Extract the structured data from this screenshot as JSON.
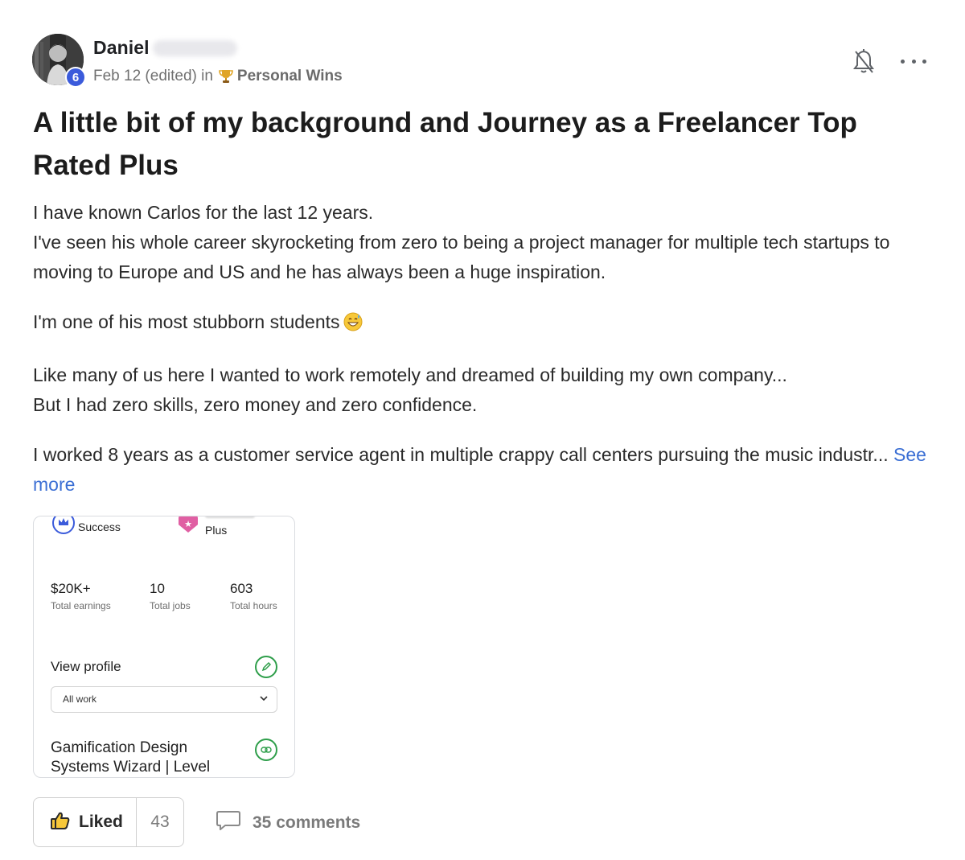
{
  "author": {
    "first_name": "Daniel",
    "level": "6"
  },
  "meta": {
    "date": "Feb 12 (edited) in",
    "category": "Personal Wins"
  },
  "post": {
    "title": "A little bit of my background and Journey as a Freelancer Top Rated Plus",
    "paragraphs": [
      [
        "I have known Carlos for the last 12 years.",
        "I've seen his whole career skyrocketing from zero to being a project manager for multiple tech startups to moving to Europe and US and he has always been a huge inspiration."
      ],
      [
        "I'm one of his most stubborn students"
      ],
      [
        "Like many of us here I wanted to work remotely and dreamed of building my own company...",
        "But I had zero skills, zero money and zero confidence."
      ],
      [
        "I worked 8 years as a customer service agent in multiple crappy call centers pursuing the music industr..."
      ]
    ],
    "see_more": "See more"
  },
  "card": {
    "badge_success": "Success",
    "badge_plus": "Plus",
    "stats": [
      {
        "value": "$20K+",
        "label": "Total earnings"
      },
      {
        "value": "10",
        "label": "Total jobs"
      },
      {
        "value": "603",
        "label": "Total hours"
      }
    ],
    "view_profile": "View profile",
    "select_value": "All work",
    "gig_title": "Gamification Design Systems Wizard | Level"
  },
  "footer": {
    "liked_label": "Liked",
    "like_count": "43",
    "comments_label": "35 comments"
  },
  "colors": {
    "link": "#3b6fd4",
    "level_badge": "#3b5bdb",
    "green": "#2e9e4a"
  }
}
